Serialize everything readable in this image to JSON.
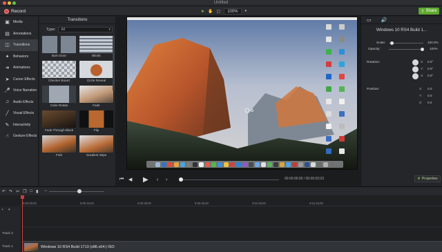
{
  "window": {
    "title": "Untitled"
  },
  "toolbar": {
    "record_label": "Record",
    "zoom": "100%",
    "share_label": "Share"
  },
  "sidebar": {
    "items": [
      {
        "label": "Media",
        "icon": "film-icon"
      },
      {
        "label": "Annotations",
        "icon": "annotation-icon"
      },
      {
        "label": "Transitions",
        "icon": "transitions-icon"
      },
      {
        "label": "Behaviors",
        "icon": "behaviors-icon"
      },
      {
        "label": "Animations",
        "icon": "animations-icon"
      },
      {
        "label": "Cursor Effects",
        "icon": "cursor-icon"
      },
      {
        "label": "Voice Narration",
        "icon": "microphone-icon"
      },
      {
        "label": "Audio Effects",
        "icon": "audio-icon"
      },
      {
        "label": "Visual Effects",
        "icon": "magic-wand-icon"
      },
      {
        "label": "Interactivity",
        "icon": "interactivity-icon"
      },
      {
        "label": "Gesture Effects",
        "icon": "gesture-icon"
      }
    ],
    "active_index": 2
  },
  "transitions": {
    "title": "Transitions",
    "type_label": "Type:",
    "type_value": "All",
    "items": [
      {
        "label": "Barn Door"
      },
      {
        "label": "Blinds"
      },
      {
        "label": "Checker Board"
      },
      {
        "label": "Circle Reveal"
      },
      {
        "label": "Cube Rotate"
      },
      {
        "label": "Fade"
      },
      {
        "label": "Fade Through Black"
      },
      {
        "label": "Flip"
      },
      {
        "label": "Fold"
      },
      {
        "label": "Gradient Wipe"
      }
    ]
  },
  "playback": {
    "timecode": "00:00:00;00 / 00:06:02;03"
  },
  "properties": {
    "title": "Windows 10 RS4 Build 1...",
    "scale_label": "Scale:",
    "scale_value": "100.0%",
    "opacity_label": "Opacity:",
    "opacity_value": "100%",
    "rotation_label": "Rotation:",
    "rotation": [
      {
        "axis": "Z:",
        "value": "0.0°"
      },
      {
        "axis": "Y:",
        "value": "0.0°"
      },
      {
        "axis": "X:",
        "value": "0.0°"
      }
    ],
    "position_label": "Position:",
    "position": [
      {
        "axis": "X:",
        "value": "0.0"
      },
      {
        "axis": "Y:",
        "value": "0.0"
      },
      {
        "axis": "Z:",
        "value": "0.0"
      }
    ],
    "properties_button": "Properties"
  },
  "timeline": {
    "ruler_labels": [
      "0:00:00;00",
      "0:00:15;00",
      "0:00:30;00",
      "0:00:45;00",
      "0:01:00;00",
      "0:01:15;00"
    ],
    "tracks": [
      {
        "label": "Track 2"
      },
      {
        "label": "Track 1"
      }
    ],
    "clip_name": "Windows 10 RS4 Build 1713 (x86.x64:) ISO"
  },
  "colors": {
    "accent_green": "#5fa82e",
    "record_red": "#e04646",
    "playhead_red": "#cf3c3c"
  }
}
